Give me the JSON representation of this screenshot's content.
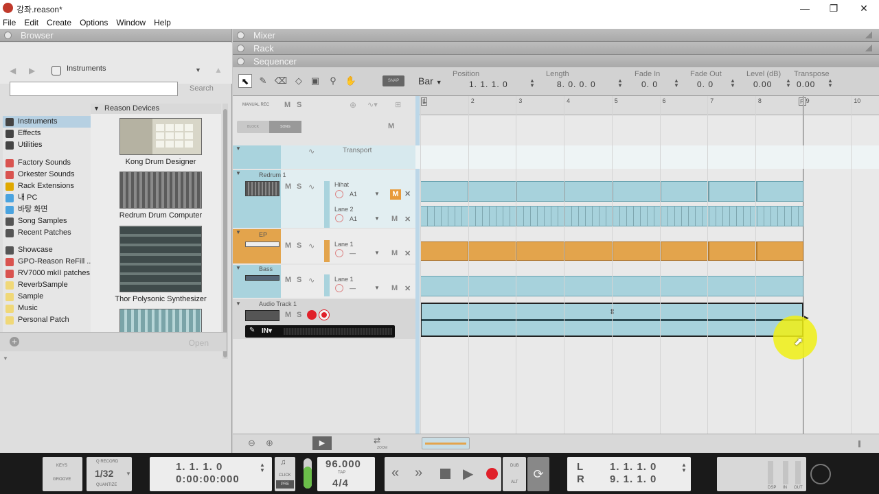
{
  "window": {
    "title": "강좌.reason*",
    "min_icon": "minimize-icon",
    "max_icon": "maximize-icon",
    "close_icon": "close-icon"
  },
  "menu": [
    "File",
    "Edit",
    "Create",
    "Options",
    "Window",
    "Help"
  ],
  "browser": {
    "title": "Browser",
    "location": "Instruments",
    "search_placeholder": "",
    "search_label": "Search",
    "open_label": "Open",
    "locations": [
      {
        "label": "Instruments",
        "icon": "instruments-icon",
        "color": "#444",
        "selected": true
      },
      {
        "label": "Effects",
        "icon": "effects-icon",
        "color": "#444"
      },
      {
        "label": "Utilities",
        "icon": "utilities-icon",
        "color": "#444"
      },
      {
        "label": "Factory Sounds",
        "icon": "factory-sounds-icon",
        "color": "#d9534f"
      },
      {
        "label": "Orkester Sounds",
        "icon": "orkester-sounds-icon",
        "color": "#d9534f"
      },
      {
        "label": "Rack Extensions",
        "icon": "rack-extensions-icon",
        "color": "#e0a800"
      },
      {
        "label": "내 PC",
        "icon": "pc-icon",
        "color": "#4aa3df"
      },
      {
        "label": "바탕 화면",
        "icon": "desktop-icon",
        "color": "#4aa3df"
      },
      {
        "label": "Song Samples",
        "icon": "song-samples-icon",
        "color": "#555"
      },
      {
        "label": "Recent Patches",
        "icon": "recent-patches-icon",
        "color": "#555"
      },
      {
        "label": "Showcase",
        "icon": "star-icon",
        "color": "#555"
      },
      {
        "label": "GPO-Reason ReFill ...",
        "icon": "refill-icon",
        "color": "#d9534f"
      },
      {
        "label": "RV7000 mkII patches",
        "icon": "refill-icon",
        "color": "#d9534f"
      },
      {
        "label": "ReverbSample",
        "icon": "folder-icon",
        "color": "#f0d878"
      },
      {
        "label": "Sample",
        "icon": "folder-icon",
        "color": "#f0d878"
      },
      {
        "label": "Music",
        "icon": "folder-icon",
        "color": "#f0d878"
      },
      {
        "label": "Personal Patch",
        "icon": "folder-icon",
        "color": "#f0d878"
      }
    ],
    "devices_header": "Reason Devices",
    "devices": [
      {
        "label": "Kong Drum Designer"
      },
      {
        "label": "Redrum Drum Computer"
      },
      {
        "label": "Thor Polysonic Synthesizer"
      }
    ]
  },
  "panels": {
    "mixer": "Mixer",
    "rack": "Rack",
    "sequencer": "Sequencer"
  },
  "toolbar": {
    "snap": "SNAP",
    "bar": "Bar",
    "position": {
      "label": "Position",
      "value": "1.  1.  1.    0"
    },
    "length": {
      "label": "Length",
      "value": "8.  0.  0.    0"
    },
    "fade_in": {
      "label": "Fade In",
      "value": "0.    0"
    },
    "fade_out": {
      "label": "Fade Out",
      "value": "0.    0"
    },
    "level": {
      "label": "Level (dB)",
      "value": "0.00"
    },
    "transpose": {
      "label": "Transpose",
      "value": "0.00"
    }
  },
  "tracklist": {
    "manual_rec": "MANUAL REC",
    "block": "BLOCK",
    "song": "SONG",
    "m": "M",
    "s": "S",
    "transport_label": "Transport",
    "tracks": [
      {
        "name": "Redrum 1",
        "lanes": [
          {
            "name": "Hihat",
            "clip": "A1",
            "muted": true
          },
          {
            "name": "Lane 2",
            "clip": "A1"
          }
        ]
      },
      {
        "name": "EP",
        "lanes": [
          {
            "name": "Lane 1",
            "clip": "—"
          }
        ]
      },
      {
        "name": "Bass",
        "lanes": [
          {
            "name": "Lane 1",
            "clip": "—"
          }
        ]
      },
      {
        "name": "Audio Track 1",
        "input": "IN▾"
      }
    ]
  },
  "ruler": {
    "bars": [
      "1",
      "2",
      "3",
      "4",
      "5",
      "6",
      "7",
      "8",
      "9",
      "10"
    ],
    "left_marker": "L",
    "right_marker": "R"
  },
  "seq_bottom": {
    "zoom": "ZOOM"
  },
  "transport": {
    "keys": "KEYS",
    "groove": "GROOVE",
    "q_record": "Q RECORD",
    "quantize_value": "1/32",
    "quantize": "QUANTIZE",
    "position_bars": "1.   1.   1.      0",
    "position_time": "0:00:00:000",
    "click": "CLICK",
    "pre": "PRE",
    "tempo": "96.000",
    "tap": "TAP",
    "signature": "4/4",
    "dub": "DUB",
    "alt": "ALT",
    "loop_left_label": "L",
    "loop_right_label": "R",
    "loop_left": "1.   1.   1.      0",
    "loop_right": "9.   1.   1.      0",
    "dsp": "DSP",
    "in": "IN",
    "out": "OUT",
    "accent_red": "#e0202a",
    "clip_blue": "#a7d2dc",
    "clip_orange": "#e3a44c"
  }
}
